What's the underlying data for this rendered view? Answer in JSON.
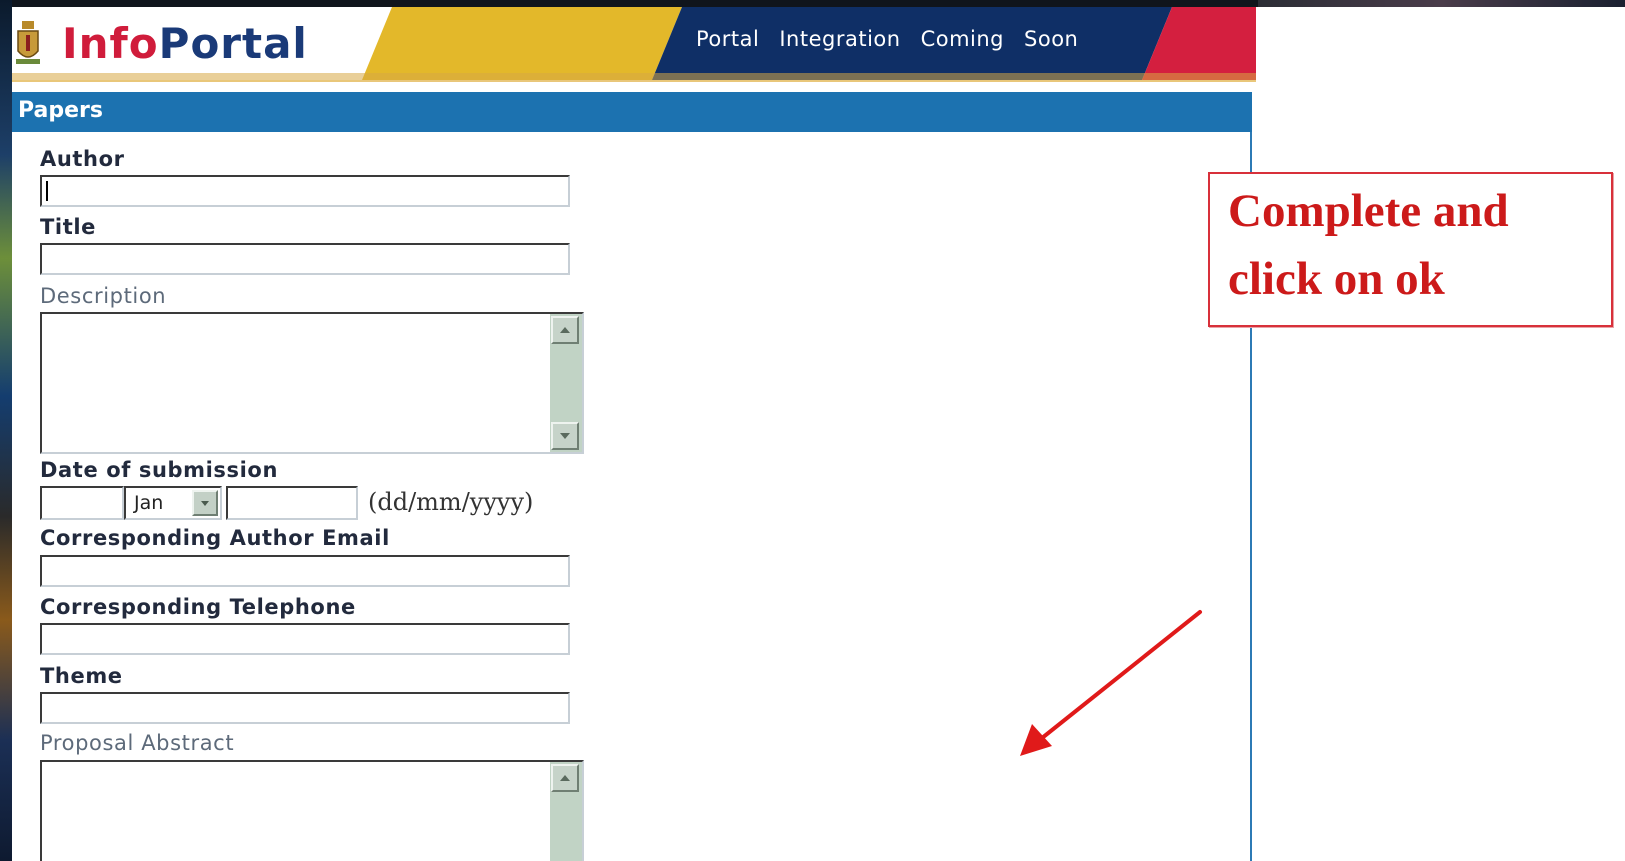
{
  "header": {
    "logo_part1": "Info",
    "logo_part2": "Portal",
    "nav": [
      "Portal",
      "Integration",
      "Coming",
      "Soon"
    ]
  },
  "panel": {
    "title": "Papers"
  },
  "form": {
    "author_label": "Author",
    "title_label": "Title",
    "description_label": "Description",
    "date_label": "Date of submission",
    "month_value": "Jan",
    "date_format": "(dd/mm/yyyy)",
    "email_label": "Corresponding Author Email",
    "telephone_label": "Corresponding Telephone",
    "theme_label": "Theme",
    "abstract_label": "Proposal Abstract"
  },
  "annotation": {
    "line1": "Complete and",
    "line2": "click on ok",
    "color": "#cc1a1a"
  },
  "colors": {
    "panel_bar": "#1c72b0",
    "header_navy": "#0f2f66",
    "header_gold": "#e3b82a",
    "header_red": "#d41f3f"
  }
}
